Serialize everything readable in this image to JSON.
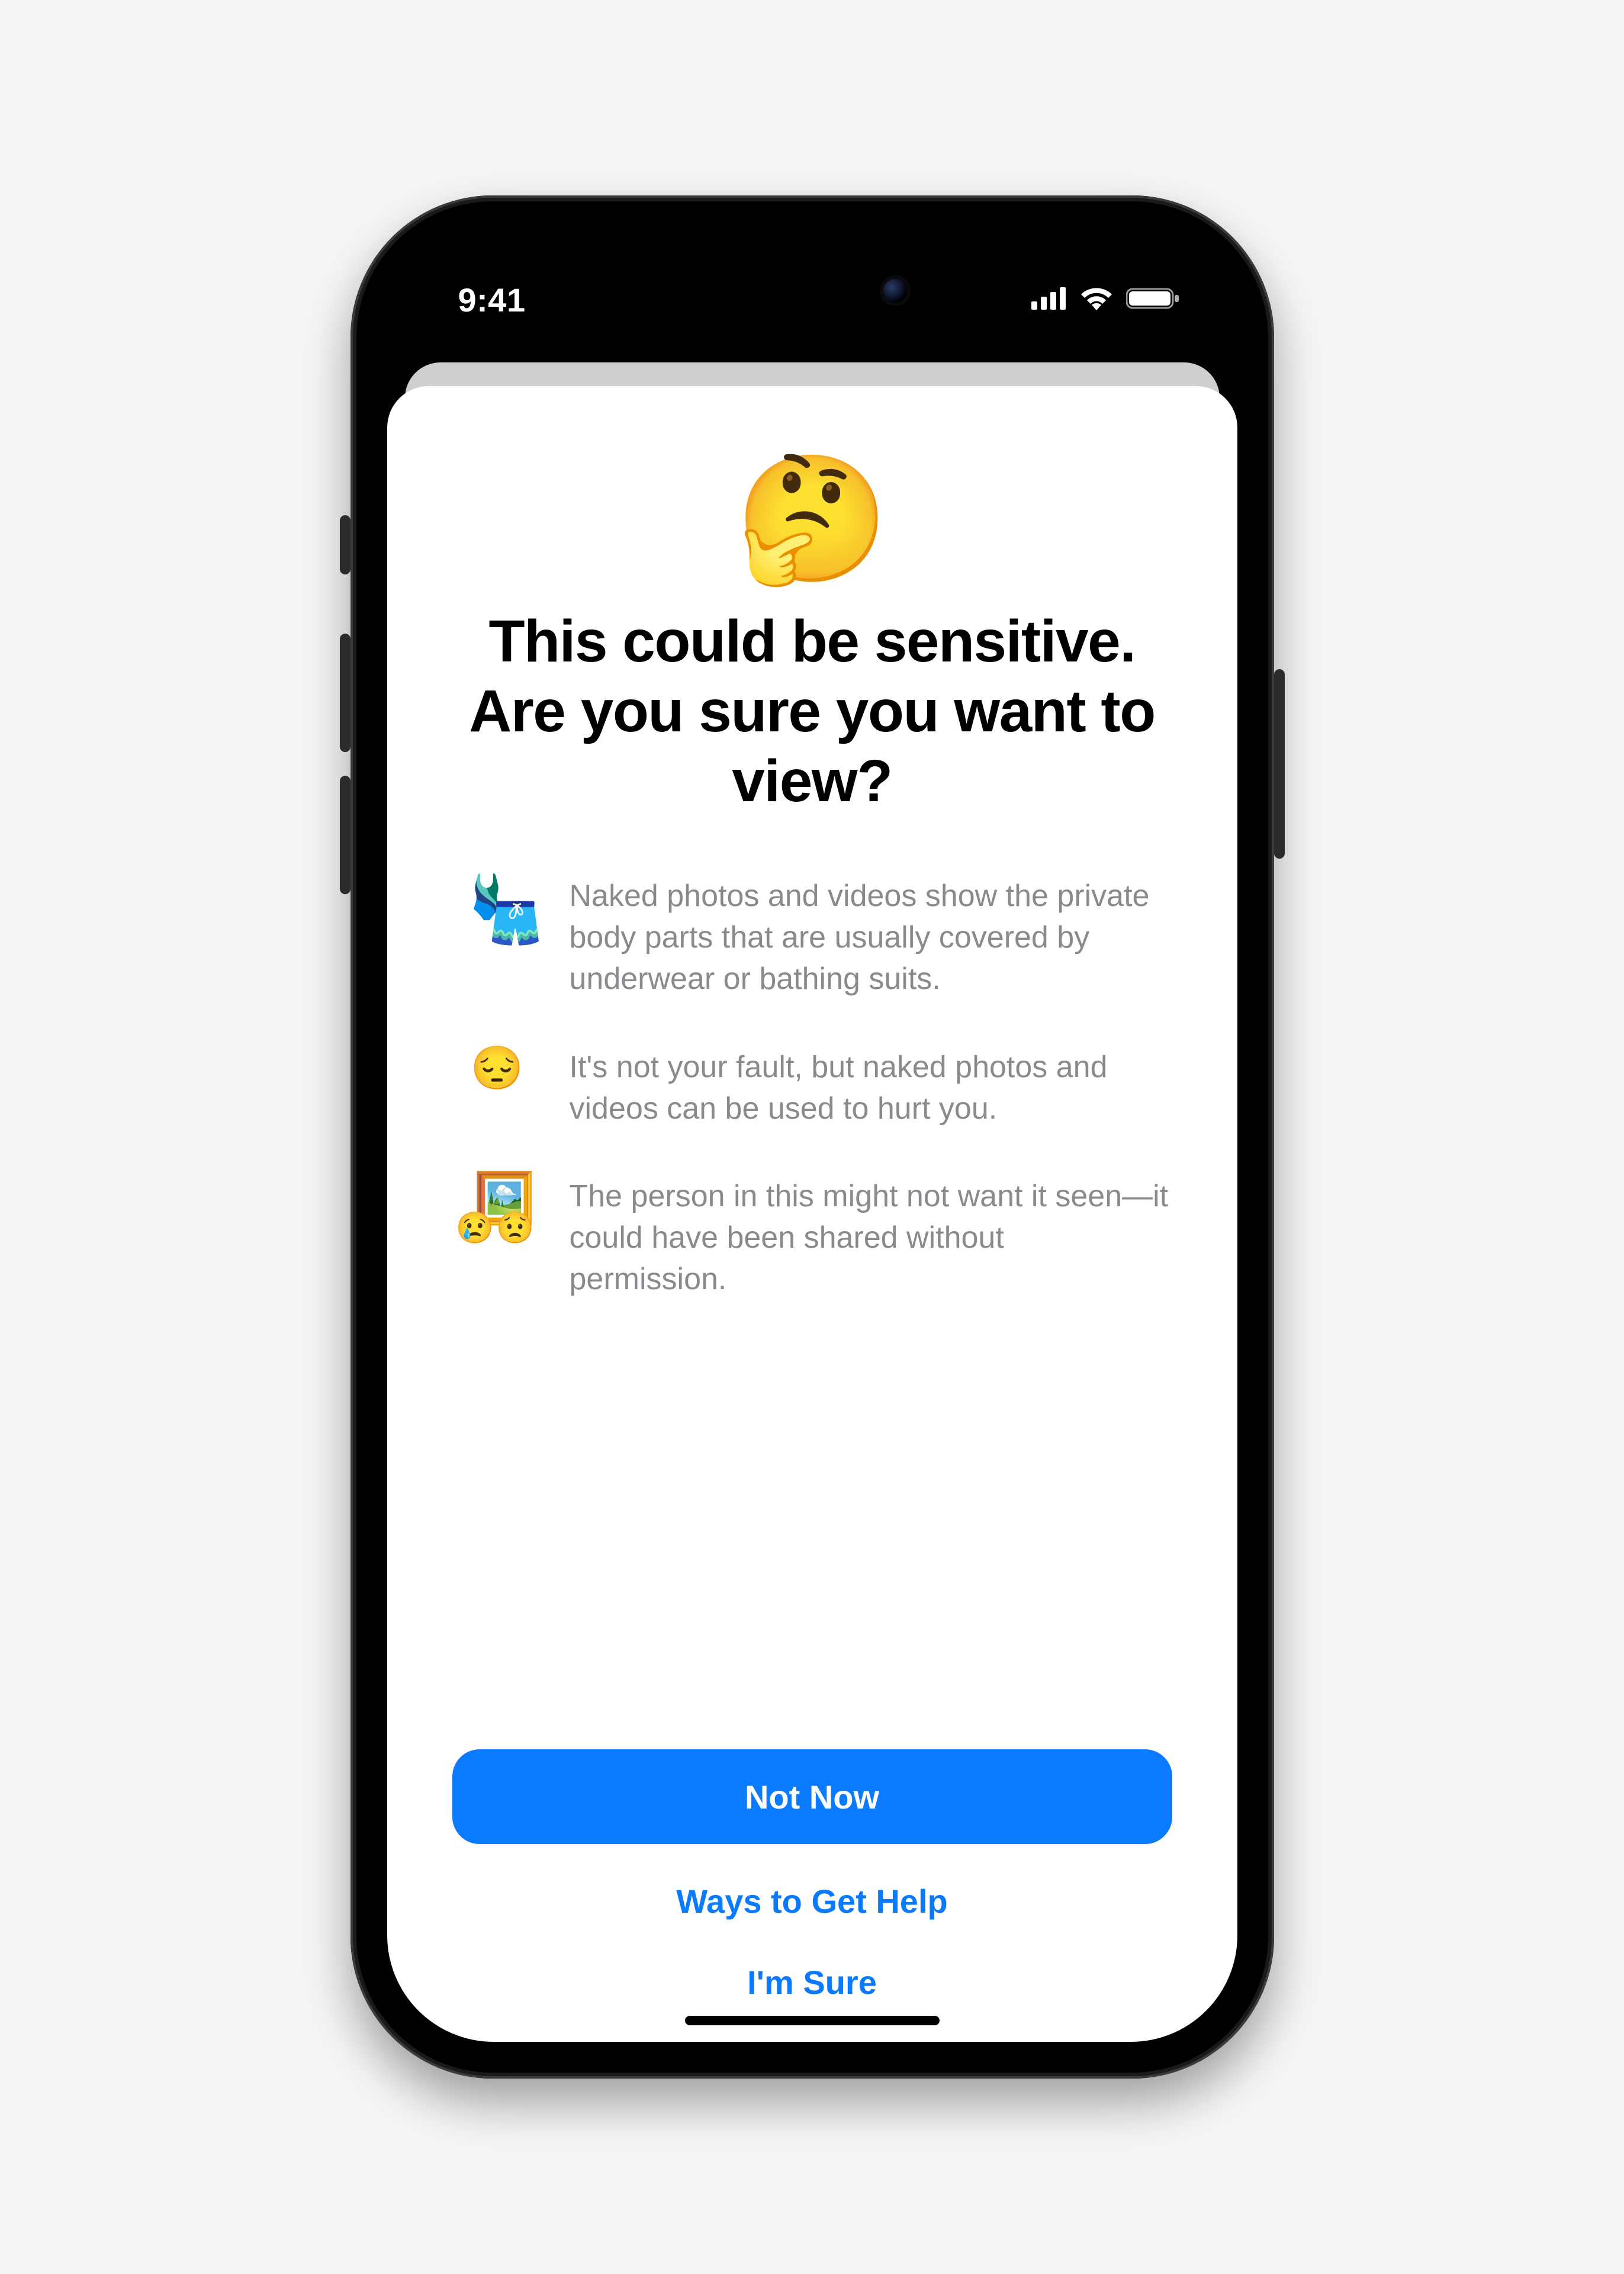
{
  "status": {
    "time": "9:41"
  },
  "hero": {
    "emoji": "🤔",
    "title_line1": "This could be sensitive.",
    "title_line2": "Are you sure you want to view?"
  },
  "bullets": [
    {
      "icon": "swimsuit-shorts",
      "text": "Naked photos and videos show the private body parts that are usually covered by underwear or bathing suits."
    },
    {
      "icon": "pensive",
      "text": "It's not your fault, but naked photos and videos can be used to hurt you."
    },
    {
      "icon": "picture-sad",
      "text": "The person in this might not want it seen—it could have been shared without permission."
    }
  ],
  "actions": {
    "primary": "Not Now",
    "secondary": "Ways to Get Help",
    "tertiary": "I'm Sure"
  }
}
